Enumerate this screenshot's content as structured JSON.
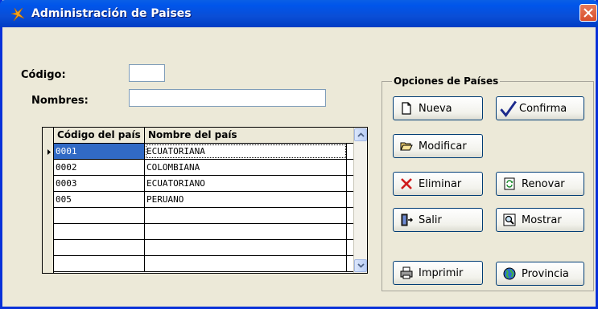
{
  "window": {
    "title": "Administración de Paises"
  },
  "form": {
    "codigo_label": "Código:",
    "codigo_value": "",
    "nombres_label": "Nombres:",
    "nombres_value": ""
  },
  "grid": {
    "columns": [
      "Código del país",
      "Nombre del país"
    ],
    "rows": [
      [
        "0001",
        "ECUATORIANA"
      ],
      [
        "0002",
        "COLOMBIANA"
      ],
      [
        "0003",
        "ECUATORIANO"
      ],
      [
        "005",
        "PERUANO"
      ],
      [
        "",
        ""
      ],
      [
        "",
        ""
      ],
      [
        "",
        ""
      ],
      [
        "",
        ""
      ]
    ],
    "selected_row": 0
  },
  "options": {
    "group_title": "Opciones de Países",
    "buttons": {
      "nueva": "Nueva",
      "confirma": "Confirma",
      "modificar": "Modificar",
      "eliminar": "Eliminar",
      "renovar": "Renovar",
      "salir": "Salir",
      "mostrar": "Mostrar",
      "imprimir": "Imprimir",
      "provincia": "Provincia"
    }
  },
  "colors": {
    "titlebar": "#0055ea",
    "face": "#ece9d8",
    "selection": "#316ac5",
    "close": "#d84f2c"
  }
}
